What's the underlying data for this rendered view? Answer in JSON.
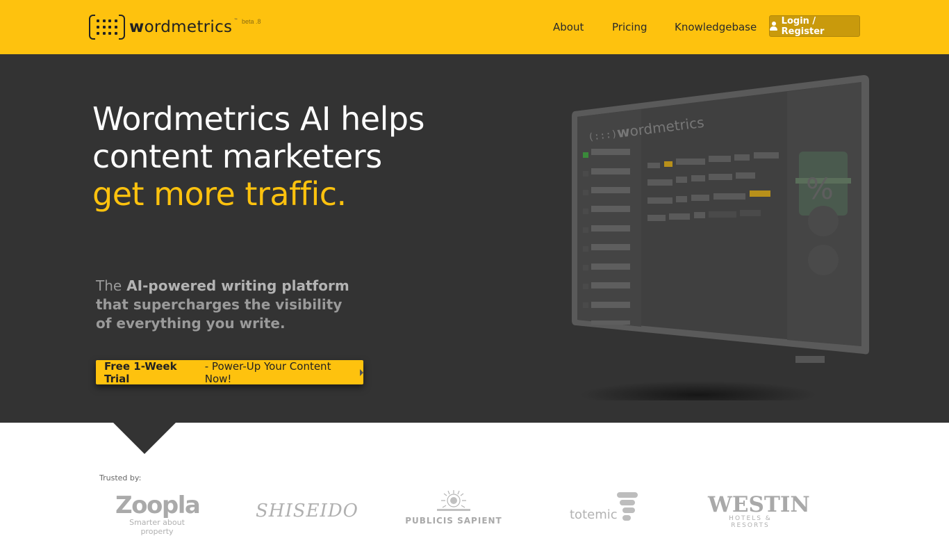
{
  "header": {
    "logo_text_bold": "w",
    "logo_text_rest": "ordmetrics",
    "logo_tm": "™",
    "beta": "beta .8",
    "nav": {
      "about": "About",
      "pricing": "Pricing",
      "knowledgebase": "Knowledgebase"
    },
    "login_label": "Login / Register"
  },
  "hero": {
    "title_line1": "Wordmetrics AI helps",
    "title_line2": "content marketers",
    "title_highlight": "get more traffic.",
    "sub_the": "The",
    "sub_strong": "AI-powered writing platform",
    "sub_rest1": "that supercharges the visibility",
    "sub_rest2": "of everything you write.",
    "cta_bold": "Free 1-Week Trial",
    "cta_rest": "- Power-Up Your Content Now!",
    "mockup_logo_bold": "w",
    "mockup_logo_rest": "ordmetrics",
    "mockup_percent": "%"
  },
  "trusted": {
    "label": "Trusted by:",
    "brands": {
      "zoopla": "Zoopla",
      "zoopla_tagline": "Smarter about property",
      "shiseido": "SHISEIDO",
      "publicis": "PUBLICIS SAPIENT",
      "totemic": "totemic",
      "westin": "WESTIN",
      "westin_tagline": "HOTELS & RESORTS"
    }
  },
  "colors": {
    "brand_yellow": "#fec20e",
    "hero_bg": "#333333",
    "login_bg": "#c99a0c"
  }
}
